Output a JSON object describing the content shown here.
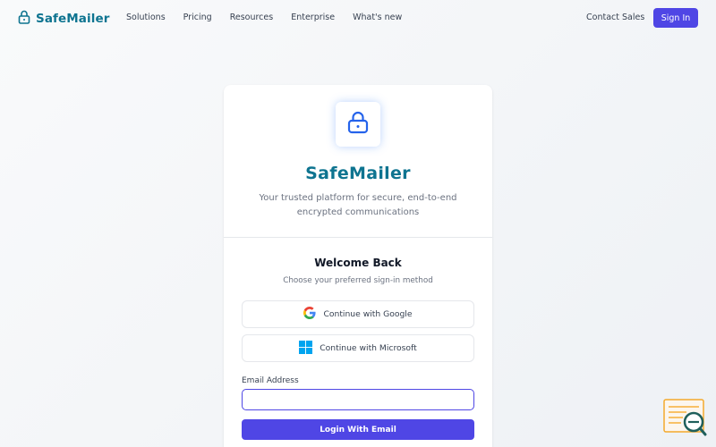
{
  "header": {
    "brand": "SafeMailer",
    "nav": [
      "Solutions",
      "Pricing",
      "Resources",
      "Enterprise",
      "What's new"
    ],
    "contact_label": "Contact Sales",
    "signin_label": "Sign In"
  },
  "card": {
    "title": "SafeMailer",
    "subtitle_line1": "Your trusted platform for secure, end-to-end",
    "subtitle_line2": "encrypted communications",
    "welcome": "Welcome Back",
    "choose": "Choose your preferred sign-in method",
    "google_label": "Continue with Google",
    "microsoft_label": "Continue with Microsoft",
    "email_label": "Email Address",
    "email_value": "",
    "email_placeholder": "",
    "login_label": "Login With Email"
  },
  "colors": {
    "brand": "#0e7490",
    "accent": "#4f46e5",
    "lock_icon": "#2563eb"
  },
  "icons": {
    "brand": "lock-icon",
    "card": "lock-icon",
    "google": "google-logo-icon",
    "microsoft": "microsoft-logo-icon",
    "widget": "feedback-search-icon"
  }
}
